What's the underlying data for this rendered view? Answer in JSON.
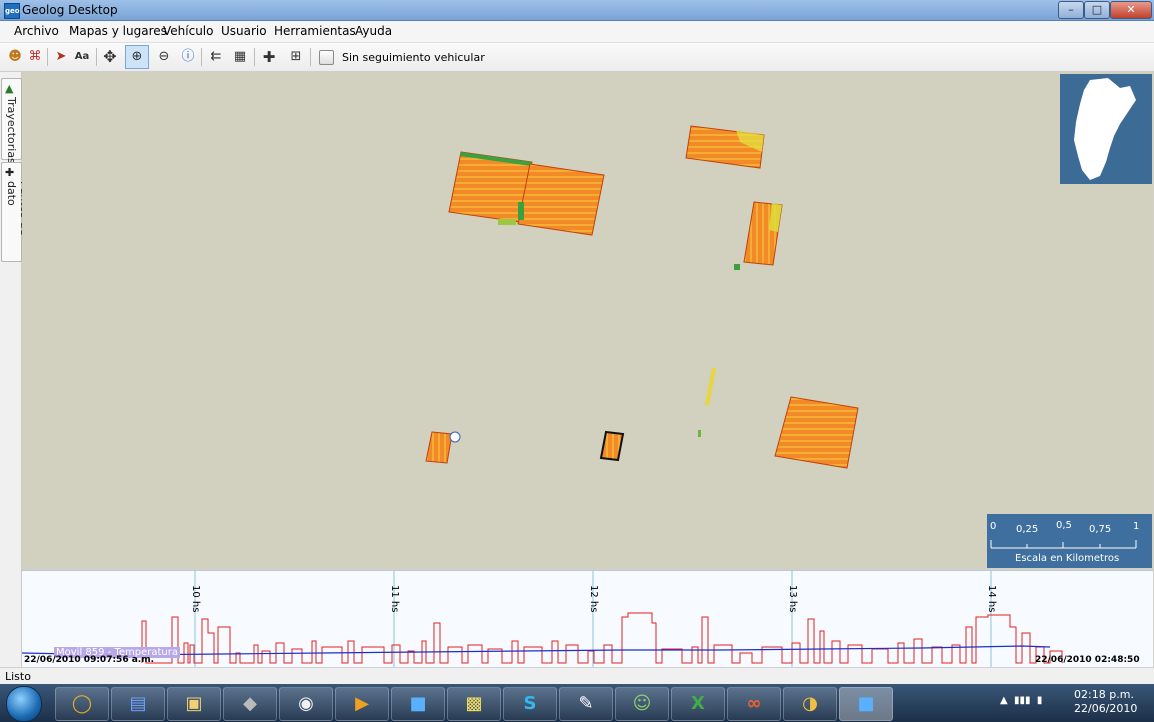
{
  "window": {
    "title": "Geolog Desktop",
    "app_icon_text": "geo log"
  },
  "window_controls": {
    "minimize": "–",
    "maximize": "□",
    "close": "✕"
  },
  "menu": {
    "archivo": "Archivo",
    "mapas": "Mapas y lugares",
    "vehiculo": "Vehículo",
    "usuario": "Usuario",
    "herramientas": "Herramientas",
    "ayuda": "Ayuda"
  },
  "toolbar": {
    "icons": [
      "user-location-icon",
      "antenna-icon",
      "route-icon",
      "a-label-icon",
      "pan-icon",
      "zoom-in-icon",
      "zoom-out-icon",
      "info-icon",
      "select-icon",
      "measure-icon",
      "crosshair-icon",
      "grid-select-icon"
    ],
    "follow_vehicle_label": "Sin seguimiento vehicular"
  },
  "side_tabs": {
    "trajectories": "Trayectorias",
    "data_points": "Puntos de dato"
  },
  "map": {
    "scale": {
      "labels": [
        "0",
        "0,25",
        "0,5",
        "0,75",
        "1"
      ],
      "caption": "Escala en Kilometros"
    }
  },
  "chart": {
    "hour_labels": [
      "10 hs",
      "11 hs",
      "12 hs",
      "13 hs",
      "14 hs"
    ],
    "legend": "Movil 859 - Temperatura",
    "start_time": "22/06/2010 09:07:56 a.m.",
    "end_time": "22/06/2010 02:48:50 p.m."
  },
  "status": {
    "text": "Listo"
  },
  "taskbar": {
    "apps": [
      "chrome-icon",
      "network-icon",
      "explorer-icon",
      "security-icon",
      "norton-icon",
      "media-icon",
      "geolog-icon",
      "sticky-notes-icon",
      "skype-icon",
      "notepad-icon",
      "messenger-icon",
      "excel-icon",
      "link-icon",
      "paint-icon",
      "geolog-active-icon"
    ],
    "time": "02:18 p.m.",
    "date": "22/06/2010"
  },
  "colors": {
    "map_bg": "#d2d0be",
    "field_orange": "#f08c2a",
    "chart_red": "#e02020",
    "chart_blue": "#1c2fc8",
    "scale_bg": "#3f6f9e"
  }
}
